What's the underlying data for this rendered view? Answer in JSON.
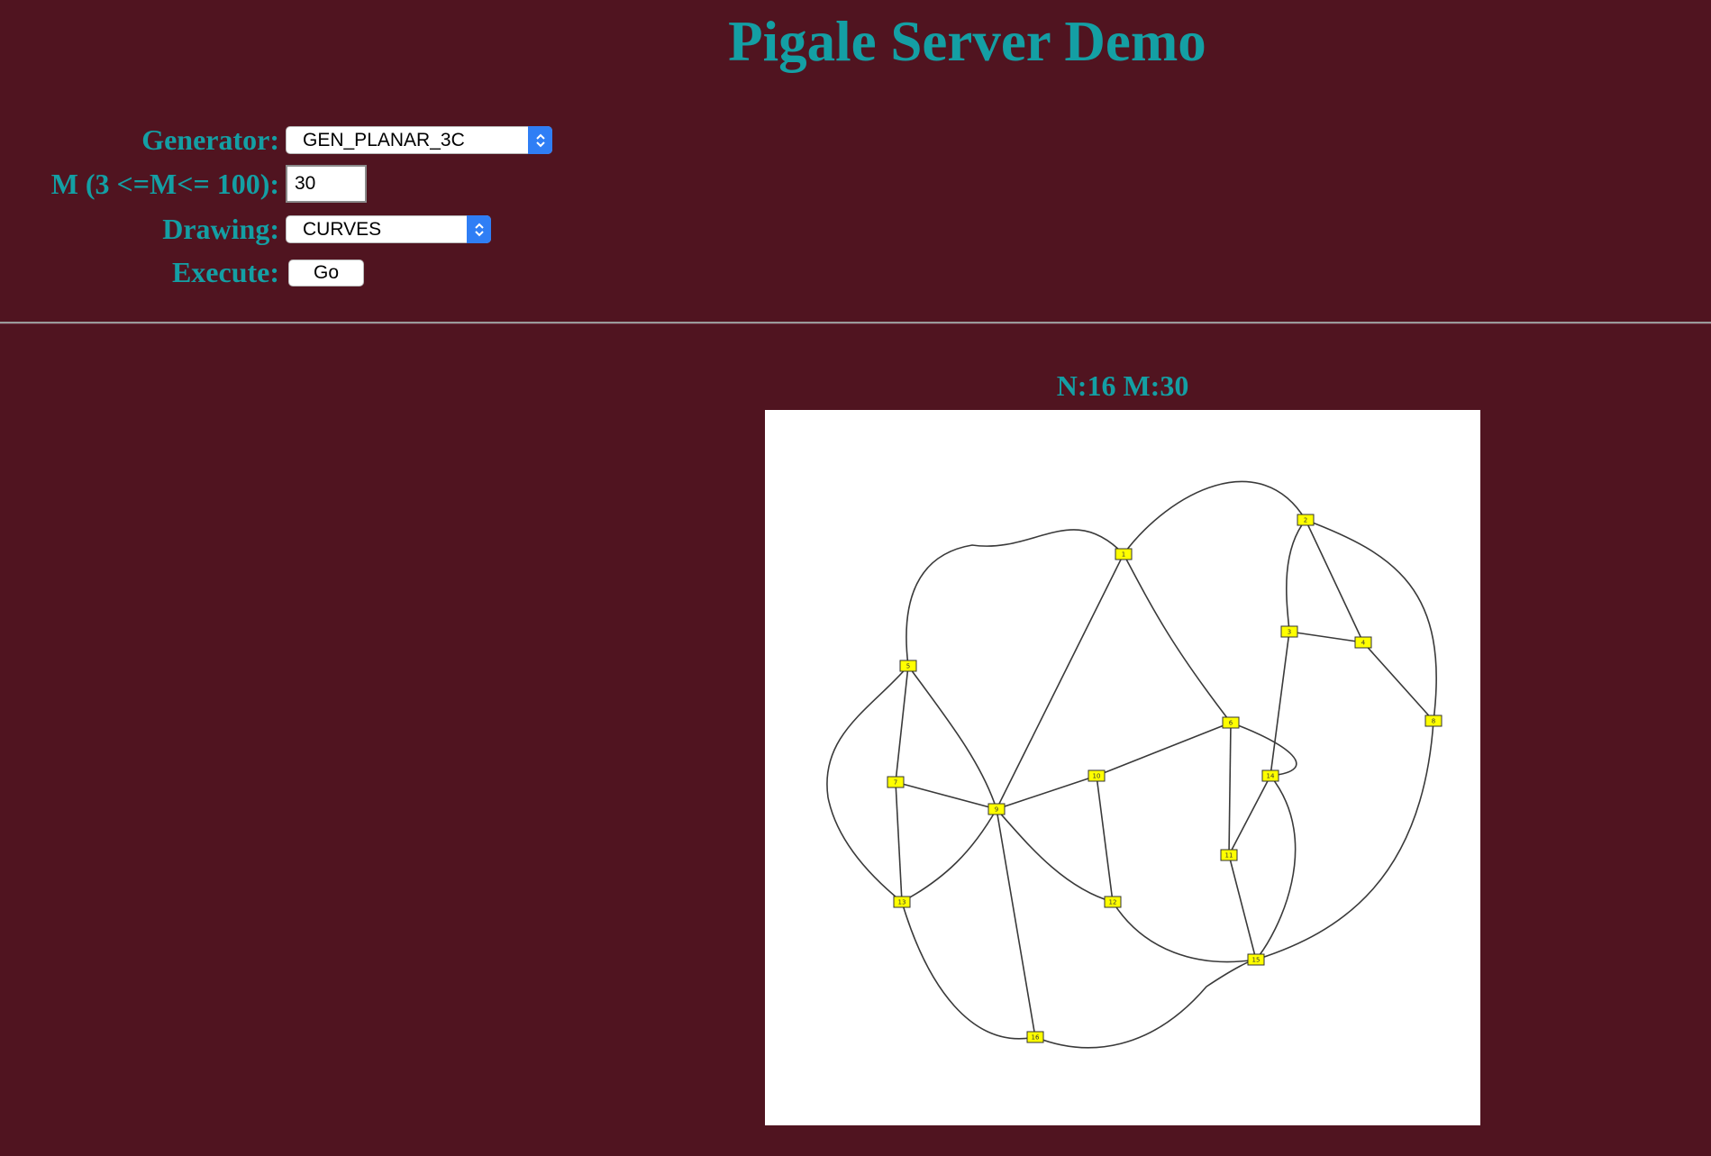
{
  "page": {
    "title": "Pigale Server Demo"
  },
  "form": {
    "generator": {
      "label": "Generator:",
      "selected": "GEN_PLANAR_3C"
    },
    "edges": {
      "label": "M (3 <=M<= 100):",
      "value": "30"
    },
    "drawing": {
      "label": "Drawing:",
      "selected": "CURVES"
    },
    "execute": {
      "label": "Execute:",
      "button_label": "Go"
    }
  },
  "graph": {
    "caption": "N:16 M:30",
    "node_fill": "#ffff00",
    "node_labels": [
      "1",
      "2",
      "3",
      "4",
      "5",
      "6",
      "7",
      "8",
      "9",
      "10",
      "11",
      "12",
      "13",
      "14",
      "15",
      "16"
    ]
  },
  "colors": {
    "background": "#501420",
    "accent": "#149fa4",
    "select_arrow": "#2f7ef5"
  }
}
